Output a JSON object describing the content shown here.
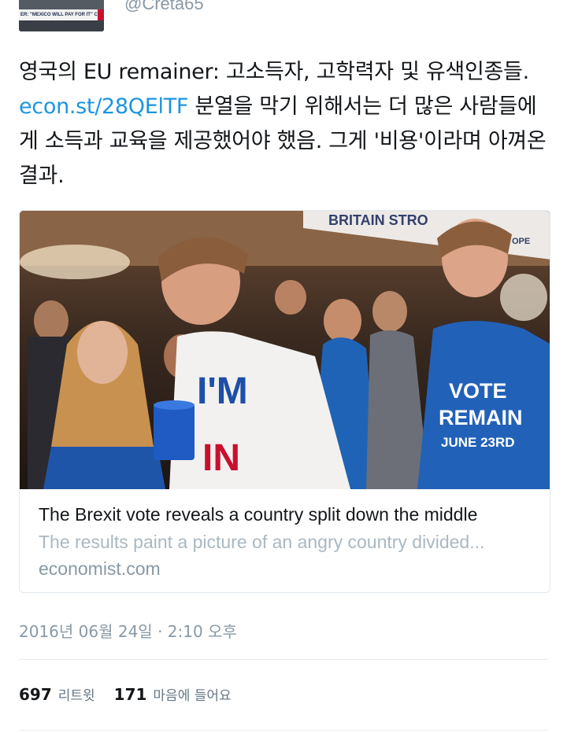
{
  "author": {
    "handle": "@Creta65",
    "avatar_caption": "ER: \"MEXICO WILL PAY FOR IT\" C"
  },
  "tweet": {
    "text_before_link": "영국의 EU remainer: 고소득자, 고학력자 및 유색인종들.  ",
    "link": "econ.st/28QElTF",
    "text_after_link": " 분열을 막기 위해서는 더 많은 사람들에게 소득과 교육을 제공했어야 했음. 그게 '비용'이라며 아껴온 결과."
  },
  "card": {
    "photo_signs": {
      "banner": "BRITAIN STRO",
      "banner_end": "OPE",
      "shirt_left_1": "I'M",
      "shirt_left_2": "IN",
      "shirt_right_1": "VOTE",
      "shirt_right_2": "REMAIN",
      "shirt_right_3": "JUNE 23RD"
    },
    "title": "The Brexit vote reveals a country split down the middle",
    "description": "The results paint a picture of an angry country divided...",
    "domain": "economist.com"
  },
  "timestamp": "2016년 06월 24일 · 2:10 오후",
  "stats": {
    "retweets_count": "697",
    "retweets_label": "리트윗",
    "likes_count": "171",
    "likes_label": "마음에 들어요"
  }
}
